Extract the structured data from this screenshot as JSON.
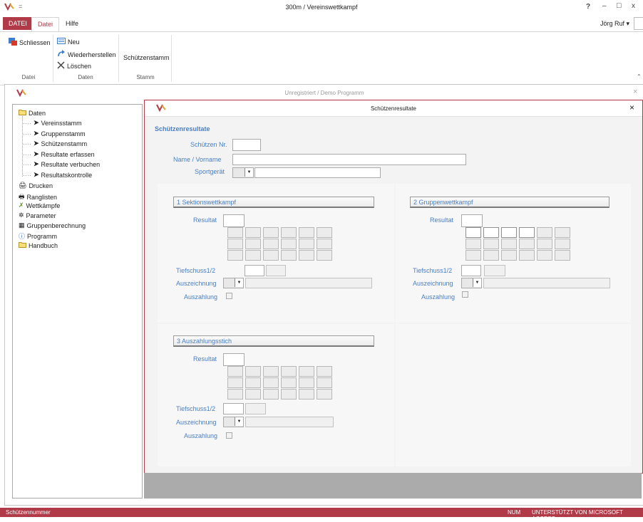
{
  "window": {
    "title": "300m / Vereinswettkampf",
    "help": "?",
    "minimize": "–",
    "restore": "□",
    "close": "x",
    "user": "Jörg Ruf"
  },
  "ribbon": {
    "tabs": [
      "DATEI",
      "Datei",
      "Hilfe"
    ],
    "buttons": {
      "schliessen": "Schliessen",
      "neu": "Neu",
      "wiederherstellen": "Wiederherstellen",
      "loeschen": "Löschen",
      "schuetzenstamm": "Schützenstamm"
    },
    "groups": [
      "Datei",
      "Daten",
      "Stamm"
    ]
  },
  "app_window": {
    "title": "Unregistriert  /  Demo Programm",
    "close": "×"
  },
  "nav": {
    "items": [
      {
        "label": "Daten",
        "icon": "folder-icon"
      },
      {
        "label": "Vereinsstamm",
        "icon": "arrow-icon"
      },
      {
        "label": "Gruppenstamm",
        "icon": "arrow-icon"
      },
      {
        "label": "Schützenstamm",
        "icon": "arrow-icon"
      },
      {
        "label": "Resultate erfassen",
        "icon": "arrow-icon"
      },
      {
        "label": "Resultate verbuchen",
        "icon": "arrow-icon"
      },
      {
        "label": "Resultatskontrolle",
        "icon": "arrow-icon"
      },
      {
        "label": "Drucken",
        "icon": "printer-icon"
      },
      {
        "label": "Ranglisten",
        "icon": "list-icon"
      },
      {
        "label": "Wettkämpfe",
        "icon": "target-icon"
      },
      {
        "label": "Parameter",
        "icon": "gear-icon"
      },
      {
        "label": "Gruppenberechnung",
        "icon": "calculator-icon"
      },
      {
        "label": "Programm",
        "icon": "info-icon"
      },
      {
        "label": "Handbuch",
        "icon": "folder-icon"
      }
    ]
  },
  "form": {
    "title": "Schützenresultate",
    "close": "×",
    "header": "Schützenresultate",
    "schuetzen_nr_label": "Schützen Nr.",
    "name_label": "Name / Vorname",
    "sportgeraet_label": "Sportgerät",
    "sections": [
      {
        "title": "1 Sektionswettkampf",
        "resultat": "Resultat",
        "tiefschuss": "Tiefschuss1/2",
        "auszeichnung": "Auszeichnung",
        "auszahlung": "Auszahlung"
      },
      {
        "title": "2 Gruppenwettkampf",
        "resultat": "Resultat",
        "tiefschuss": "Tiefschuss1/2",
        "auszeichnung": "Auszeichnung",
        "auszahlung": "Auszahlung"
      },
      {
        "title": "3 Auszahlungsstich",
        "resultat": "Resultat",
        "tiefschuss": "Tiefschuss1/2",
        "auszeichnung": "Auszeichnung",
        "auszahlung": "Auszahlung"
      }
    ]
  },
  "status": {
    "left": "Schützennummer",
    "num": "NUM",
    "right": "UNTERSTÜTZT VON MICROSOFT ACCESS"
  },
  "colors": {
    "accent": "#b03a48",
    "label_blue": "#4a7fc1"
  }
}
